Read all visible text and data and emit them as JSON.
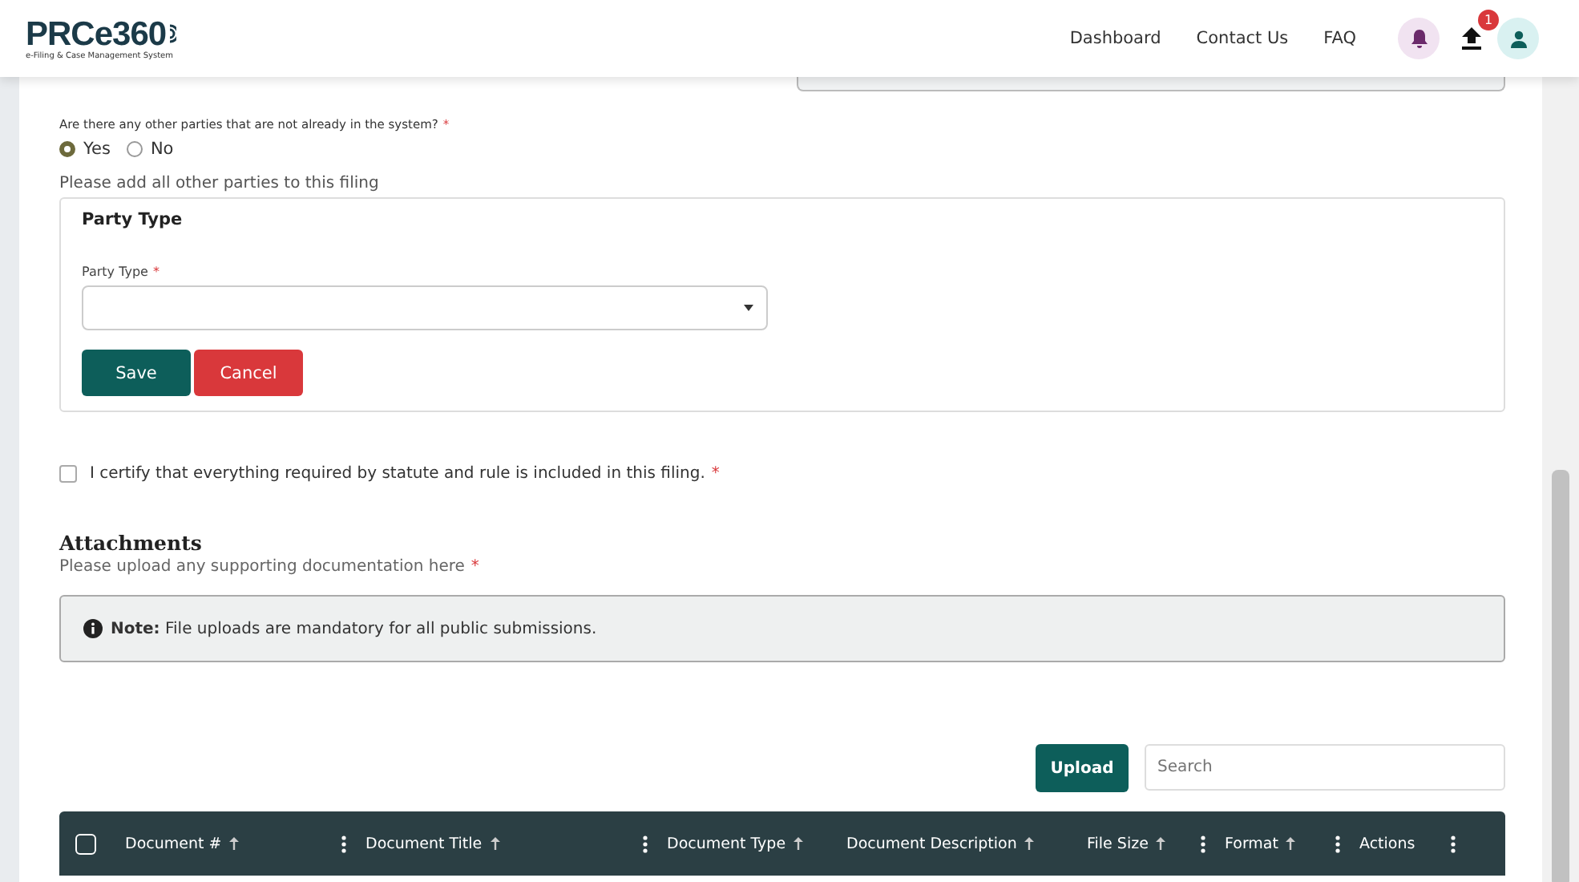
{
  "header": {
    "logo": "PRCe360",
    "tagline": "e-Filing & Case Management System",
    "nav": [
      "Dashboard",
      "Contact Us",
      "FAQ"
    ],
    "upload_badge": "1"
  },
  "question": {
    "label": "Are there any other parties that are not already in the system?",
    "required_mark": "*",
    "options": [
      {
        "label": "Yes",
        "selected": true
      },
      {
        "label": "No",
        "selected": false
      }
    ]
  },
  "add_hint": "Please add all other parties to this filing",
  "party_panel": {
    "title": "Party Type",
    "field_label": "Party Type",
    "required_mark": "*",
    "buttons": [
      {
        "label": "Save",
        "kind": "primary"
      },
      {
        "label": "Cancel",
        "kind": "danger"
      }
    ]
  },
  "certify": {
    "label": "I certify that everything required by statute and rule is included in this filing.",
    "checked": false,
    "required_mark": "*"
  },
  "attachments": {
    "title": "Attachments",
    "hint": "Please upload any supporting documentation here",
    "required_mark": "*",
    "note": "**Note:** File uploads are mandatory for all public submissions.",
    "upload_button": "Upload",
    "search_placeholder": "Search",
    "select_all_checked": false,
    "columns": [
      {
        "label": "Document #",
        "sortable": true,
        "menu": true
      },
      {
        "label": "Document Title",
        "sortable": true,
        "menu": true
      },
      {
        "label": "Document Type",
        "sortable": true,
        "menu": false
      },
      {
        "label": "Document Description",
        "sortable": true,
        "menu": false
      },
      {
        "label": "File Size",
        "sortable": true,
        "menu": true
      },
      {
        "label": "Format",
        "sortable": true,
        "menu": true
      },
      {
        "label": "Actions",
        "sortable": false,
        "menu": true
      }
    ]
  }
}
